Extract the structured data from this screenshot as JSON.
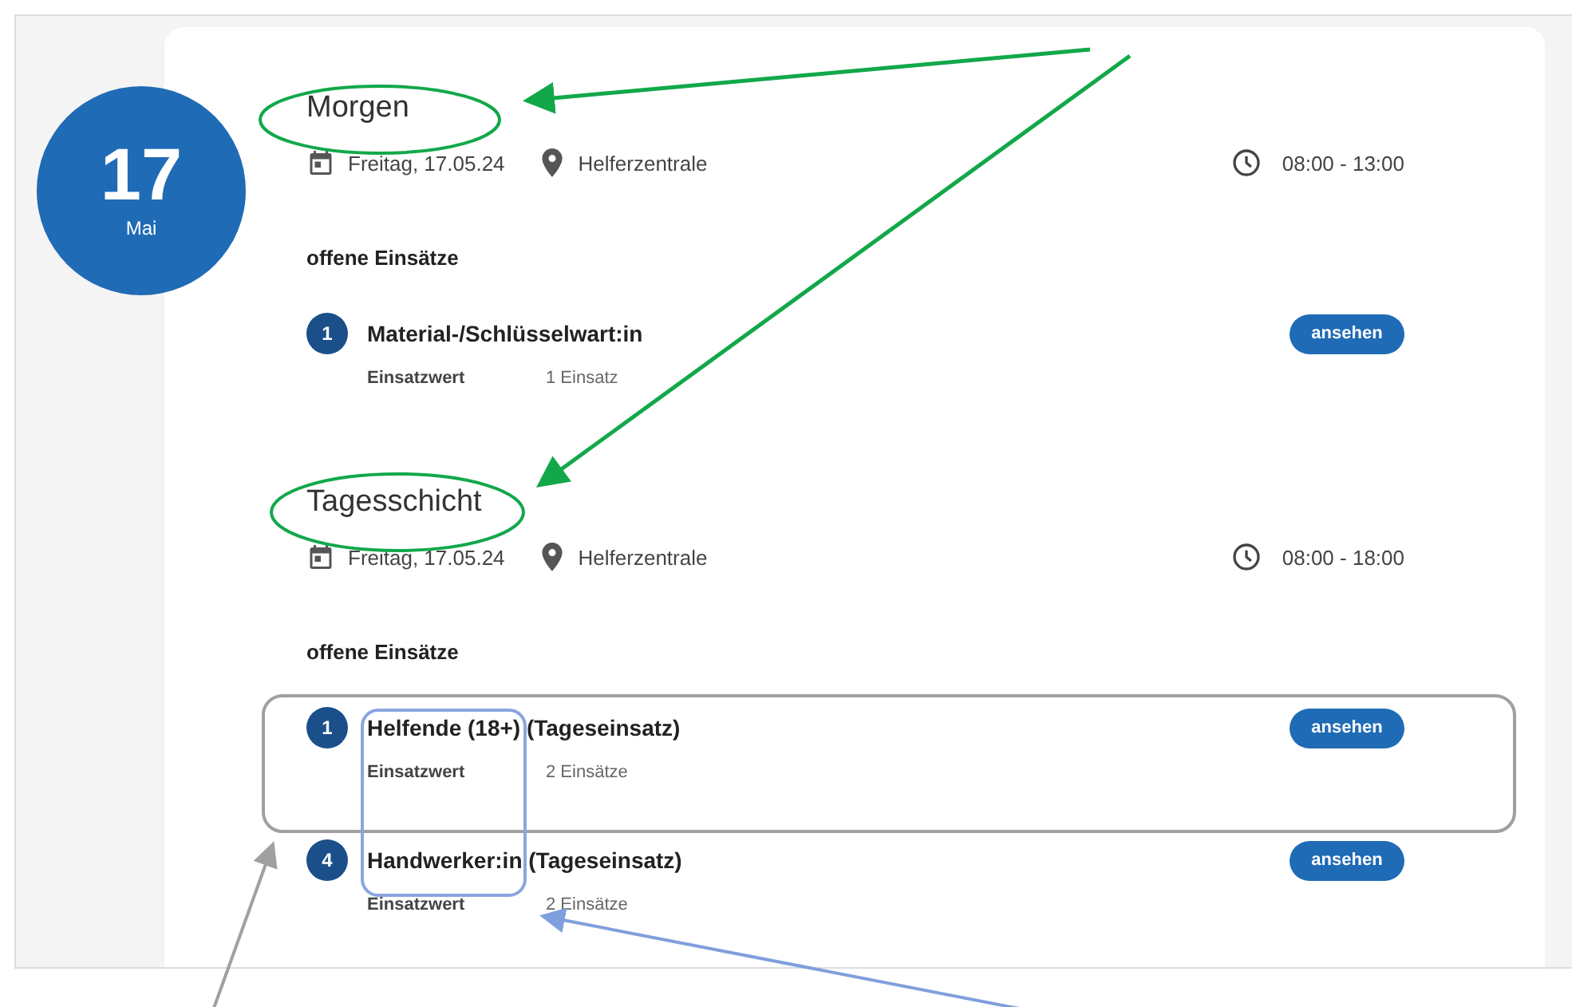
{
  "date_badge": {
    "day": "17",
    "month": "Mai"
  },
  "shifts": [
    {
      "title": "Morgen",
      "date": "Freitag, 17.05.24",
      "location": "Helferzentrale",
      "time": "08:00 - 13:00",
      "section_heading": "offene Einsätze",
      "tasks": [
        {
          "count": "1",
          "name": "Material-/Schlüsselwart:in",
          "label": "Einsatzwert",
          "value": "1 Einsatz",
          "button": "ansehen"
        }
      ]
    },
    {
      "title": "Tagesschicht",
      "date": "Freitag, 17.05.24",
      "location": "Helferzentrale",
      "time": "08:00 - 18:00",
      "section_heading": "offene Einsätze",
      "tasks": [
        {
          "count": "1",
          "name": "Helfende (18+) (Tageseinsatz)",
          "label": "Einsatzwert",
          "value": "2 Einsätze",
          "button": "ansehen"
        },
        {
          "count": "4",
          "name": "Handwerker:in (Tageseinsatz)",
          "label": "Einsatzwert",
          "value": "2 Einsätze",
          "button": "ansehen"
        }
      ]
    }
  ]
}
